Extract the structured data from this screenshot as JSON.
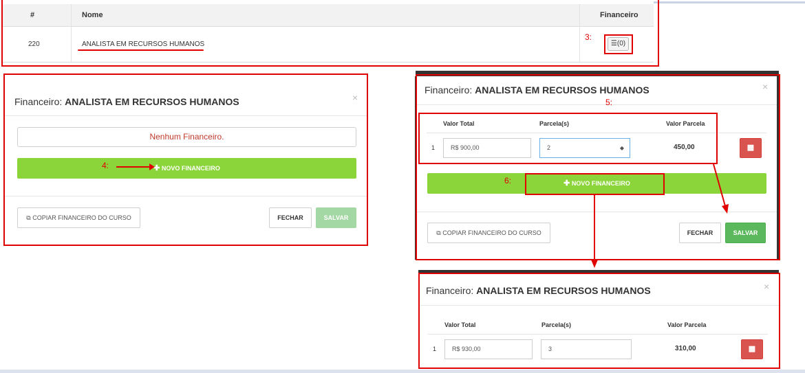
{
  "table": {
    "headers": {
      "num": "#",
      "nome": "Nome",
      "financeiro": "Financeiro"
    },
    "row": {
      "num": "220",
      "nome": "ANALISTA EM RECURSOS HUMANOS",
      "financeiro_count": "(0)"
    }
  },
  "annotations": {
    "step3": "3:",
    "step4": "4:",
    "step5": "5:",
    "step6": "6:"
  },
  "modal_empty": {
    "title_prefix": "Financeiro:",
    "title_name": "ANALISTA EM RECURSOS HUMANOS",
    "close": "×",
    "empty_message": "Nenhum Financeiro.",
    "novo_label": "NOVO FINANCEIRO",
    "copy_label": "COPIAR FINANCEIRO DO CURSO",
    "fechar_label": "FECHAR",
    "salvar_label": "SALVAR"
  },
  "modal_filled": {
    "title_prefix": "Financeiro:",
    "title_name": "ANALISTA EM RECURSOS HUMANOS",
    "close": "×",
    "columns": {
      "valor_total": "Valor Total",
      "parcelas": "Parcela(s)",
      "valor_parcela": "Valor Parcela"
    },
    "row": {
      "index": "1",
      "valor_total": "R$ 900,00",
      "parcelas": "2",
      "valor_parcela": "450,00"
    },
    "novo_label": "NOVO FINANCEIRO",
    "copy_label": "COPIAR FINANCEIRO DO CURSO",
    "fechar_label": "FECHAR",
    "salvar_label": "SALVAR"
  },
  "modal_result": {
    "title_prefix": "Financeiro:",
    "title_name": "ANALISTA EM RECURSOS HUMANOS",
    "close": "×",
    "columns": {
      "valor_total": "Valor Total",
      "parcelas": "Parcela(s)",
      "valor_parcela": "Valor Parcela"
    },
    "row": {
      "index": "1",
      "valor_total": "R$ 930,00",
      "parcelas": "3",
      "valor_parcela": "310,00"
    }
  },
  "colors": {
    "annotation": "#e00000",
    "green": "#8bd439",
    "save": "#5cb85c",
    "danger": "#d9534f"
  }
}
